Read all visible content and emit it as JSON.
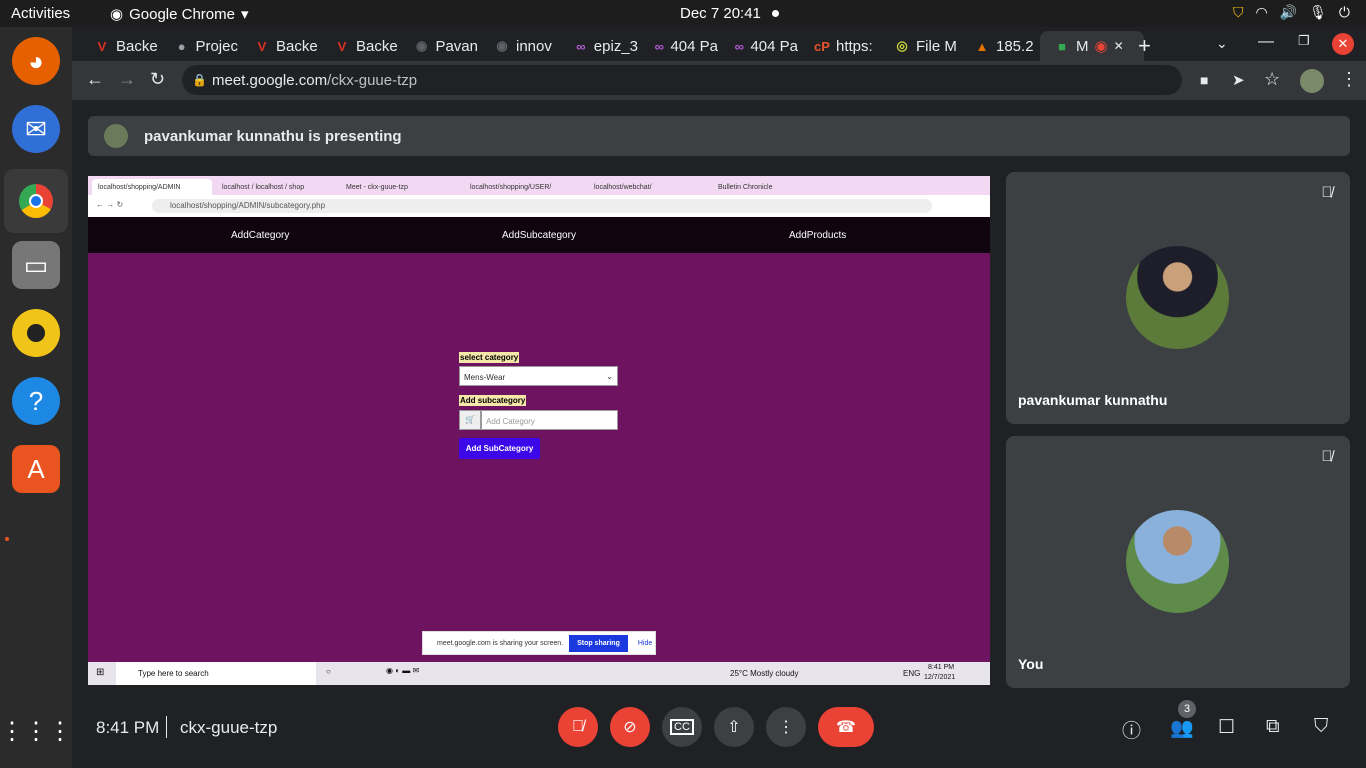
{
  "topbar": {
    "activities": "Activities",
    "app": "Google Chrome",
    "datetime": "Dec 7  20:41"
  },
  "dock": {
    "items": [
      "firefox-icon",
      "thunderbird-icon",
      "chrome-icon",
      "files-icon",
      "rhythmbox-icon",
      "help-icon",
      "software-icon",
      "apps-grid-icon"
    ]
  },
  "tabs": [
    {
      "label": "Backe",
      "icon": "V",
      "color": "#d93025"
    },
    {
      "label": "Projec",
      "icon": "●",
      "color": "#9aa0a6"
    },
    {
      "label": "Backe",
      "icon": "V",
      "color": "#d93025"
    },
    {
      "label": "Backe",
      "icon": "V",
      "color": "#d93025"
    },
    {
      "label": "Pavan",
      "icon": "◉",
      "color": "#5f6368"
    },
    {
      "label": "innov",
      "icon": "◉",
      "color": "#5f6368"
    },
    {
      "label": "epiz_3",
      "icon": "∞",
      "color": "#b35cd8"
    },
    {
      "label": "404 Pa",
      "icon": "∞",
      "color": "#b35cd8"
    },
    {
      "label": "404 Pa",
      "icon": "∞",
      "color": "#b35cd8"
    },
    {
      "label": "https:",
      "icon": "cP",
      "color": "#e8542a"
    },
    {
      "label": "File M",
      "icon": "◎",
      "color": "#c6d43a"
    },
    {
      "label": "185.2",
      "icon": "▲",
      "color": "#e37400"
    },
    {
      "label": "M",
      "icon": "■",
      "color": "#34a853"
    }
  ],
  "address": {
    "domain": "meet.google.com",
    "path": "/ckx-guue-tzp"
  },
  "meet": {
    "presenting": "pavankumar kunnathu is presenting",
    "participants": [
      {
        "name": "pavankumar kunnathu"
      },
      {
        "name": "You"
      }
    ],
    "time": "8:41 PM",
    "code": "ckx-guue-tzp",
    "people_count": "3"
  },
  "shared": {
    "tabs": [
      "localhost/shopping/ADMIN",
      "localhost / localhost / shop",
      "Meet - ckx-guue-tzp",
      "localhost/shopping/USER/",
      "localhost/webchat/",
      "Bulletin Chronicle"
    ],
    "url": "localhost/shopping/ADMIN/subcategory.php",
    "nav": [
      "AddCategory",
      "AddSubcategory",
      "AddProducts"
    ],
    "select_label": "select category",
    "select_value": "Mens-Wear",
    "sub_label": "Add subcategory",
    "sub_placeholder": "Add Category",
    "submit": "Add SubCategory",
    "notice": "meet.google.com is sharing your screen.",
    "stop": "Stop sharing",
    "hide": "Hide",
    "taskbar_search": "Type here to search",
    "weather": "25°C  Mostly cloudy",
    "lang": "ENG",
    "win_time": "8:41 PM",
    "win_date": "12/7/2021"
  }
}
